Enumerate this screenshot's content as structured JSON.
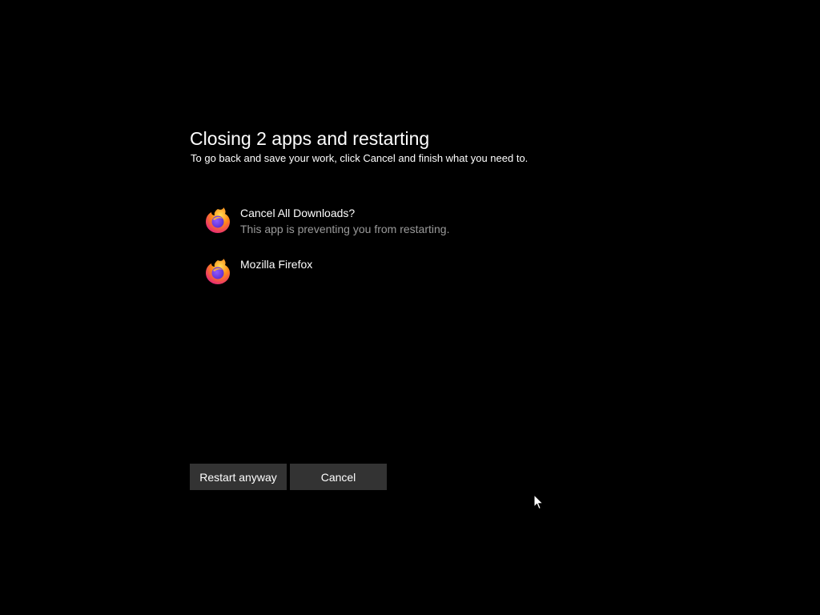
{
  "dialog": {
    "title": "Closing 2 apps and restarting",
    "subtitle": "To go back and save your work, click Cancel and finish what you need to."
  },
  "apps": [
    {
      "name": "Cancel All Downloads?",
      "status": "This app is preventing you from restarting.",
      "icon": "firefox-icon"
    },
    {
      "name": "Mozilla Firefox",
      "status": "",
      "icon": "firefox-icon"
    }
  ],
  "buttons": {
    "restart_label": "Restart anyway",
    "cancel_label": "Cancel"
  },
  "colors": {
    "background": "#000000",
    "button": "#333333",
    "secondary_text": "#9a9a9a"
  },
  "cursor": {
    "icon": "mouse-pointer-icon"
  }
}
